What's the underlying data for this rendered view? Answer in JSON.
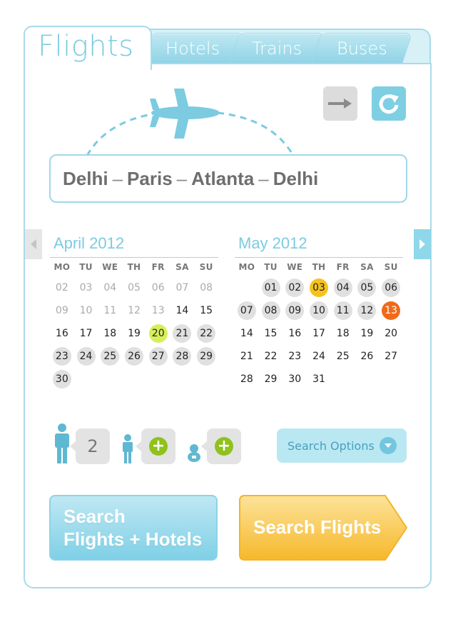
{
  "tabs": {
    "flights": "Flights",
    "hotels": "Hotels",
    "trains": "Trains",
    "buses": "Buses"
  },
  "route": {
    "cities": [
      "Delhi",
      "Paris",
      "Atlanta",
      "Delhi"
    ],
    "separator": "–"
  },
  "calendar": {
    "weekdays": [
      "MO",
      "TU",
      "WE",
      "TH",
      "FR",
      "SA",
      "SU"
    ],
    "months": [
      {
        "title": "April 2012",
        "days": [
          {
            "d": "02",
            "s": "past"
          },
          {
            "d": "03",
            "s": "past"
          },
          {
            "d": "04",
            "s": "past"
          },
          {
            "d": "05",
            "s": "past"
          },
          {
            "d": "06",
            "s": "past"
          },
          {
            "d": "07",
            "s": "past"
          },
          {
            "d": "08",
            "s": "past"
          },
          {
            "d": "09",
            "s": "past"
          },
          {
            "d": "10",
            "s": "past"
          },
          {
            "d": "11",
            "s": "past"
          },
          {
            "d": "12",
            "s": "past"
          },
          {
            "d": "13",
            "s": "past"
          },
          {
            "d": "14",
            "s": "plain"
          },
          {
            "d": "15",
            "s": "plain"
          },
          {
            "d": "16",
            "s": "plain"
          },
          {
            "d": "17",
            "s": "plain"
          },
          {
            "d": "18",
            "s": "plain"
          },
          {
            "d": "19",
            "s": "plain"
          },
          {
            "d": "20",
            "s": "sel-green"
          },
          {
            "d": "21",
            "s": "avail"
          },
          {
            "d": "22",
            "s": "avail"
          },
          {
            "d": "23",
            "s": "avail"
          },
          {
            "d": "24",
            "s": "avail"
          },
          {
            "d": "25",
            "s": "avail"
          },
          {
            "d": "26",
            "s": "avail"
          },
          {
            "d": "27",
            "s": "avail"
          },
          {
            "d": "28",
            "s": "avail"
          },
          {
            "d": "29",
            "s": "avail"
          },
          {
            "d": "30",
            "s": "avail"
          }
        ]
      },
      {
        "title": "May 2012",
        "days": [
          {
            "d": "",
            "s": "blank"
          },
          {
            "d": "01",
            "s": "avail"
          },
          {
            "d": "02",
            "s": "avail"
          },
          {
            "d": "03",
            "s": "sel-yellow"
          },
          {
            "d": "04",
            "s": "avail"
          },
          {
            "d": "05",
            "s": "avail"
          },
          {
            "d": "06",
            "s": "avail"
          },
          {
            "d": "07",
            "s": "avail"
          },
          {
            "d": "08",
            "s": "avail"
          },
          {
            "d": "09",
            "s": "avail"
          },
          {
            "d": "10",
            "s": "avail"
          },
          {
            "d": "11",
            "s": "avail"
          },
          {
            "d": "12",
            "s": "avail"
          },
          {
            "d": "13",
            "s": "sel-orange"
          },
          {
            "d": "14",
            "s": "plain"
          },
          {
            "d": "15",
            "s": "plain"
          },
          {
            "d": "16",
            "s": "plain"
          },
          {
            "d": "17",
            "s": "plain"
          },
          {
            "d": "18",
            "s": "plain"
          },
          {
            "d": "19",
            "s": "plain"
          },
          {
            "d": "20",
            "s": "plain"
          },
          {
            "d": "21",
            "s": "plain"
          },
          {
            "d": "22",
            "s": "plain"
          },
          {
            "d": "23",
            "s": "plain"
          },
          {
            "d": "24",
            "s": "plain"
          },
          {
            "d": "25",
            "s": "plain"
          },
          {
            "d": "26",
            "s": "plain"
          },
          {
            "d": "27",
            "s": "plain"
          },
          {
            "d": "28",
            "s": "plain"
          },
          {
            "d": "29",
            "s": "plain"
          },
          {
            "d": "30",
            "s": "plain"
          },
          {
            "d": "31",
            "s": "plain"
          }
        ]
      }
    ]
  },
  "passengers": {
    "adults": "2",
    "child_icon": "child-icon",
    "infant_icon": "infant-icon"
  },
  "search_options_label": "Search Options",
  "buttons": {
    "flights_hotels_line1": "Search",
    "flights_hotels_line2": "Flights + Hotels",
    "search_flights": "Search Flights"
  },
  "colors": {
    "accent": "#7ccbe0",
    "selected_start": "#d7ef5a",
    "selected_mid": "#f6c21d",
    "selected_end": "#f06a1c",
    "cta": "#f8c443",
    "plus": "#8fc21d"
  }
}
